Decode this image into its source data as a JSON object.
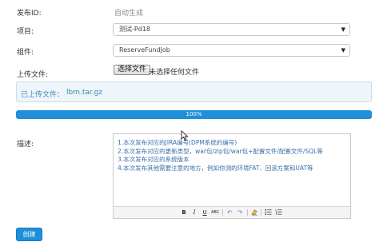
{
  "form": {
    "publish_id_label": "发布ID:",
    "publish_id_value": "自动生成",
    "project_label": "项目:",
    "project_value": "测试-Pd18",
    "group_label": "组件:",
    "group_value": "ReserveFundJob",
    "upload_label": "上传文件:",
    "file_button": "选择文件",
    "file_status": "未选择任何文件",
    "uploaded_label": "已上传文件：",
    "uploaded_file": "lbm.tar.gz",
    "progress_percent": 100,
    "progress_text": "100%",
    "desc_label": "描述:",
    "desc_lines": [
      "1.本次发布对应的JIRA编号(DPM系统的编号)",
      "2.本次发布对应的更新类型，war包/zip包/war包+配置文件/配置文件/SQL等",
      "3.本次发布对应的系统版本",
      "4.本次发布其他需要注意的地方，例如你测的环境FAT、回滚方案和UAT等"
    ],
    "create_button": "创建"
  },
  "toolbar_icons": [
    "bold-icon",
    "italic-icon",
    "underline-icon",
    "strikethrough-icon",
    "undo-icon",
    "redo-icon",
    "eraser-icon",
    "bullet-list-icon",
    "numbered-list-icon"
  ],
  "colors": {
    "primary": "#1e8fd8",
    "info_text": "#3a87ad",
    "info_bg": "#eef6fb",
    "desc_text": "#3b6fa8"
  }
}
